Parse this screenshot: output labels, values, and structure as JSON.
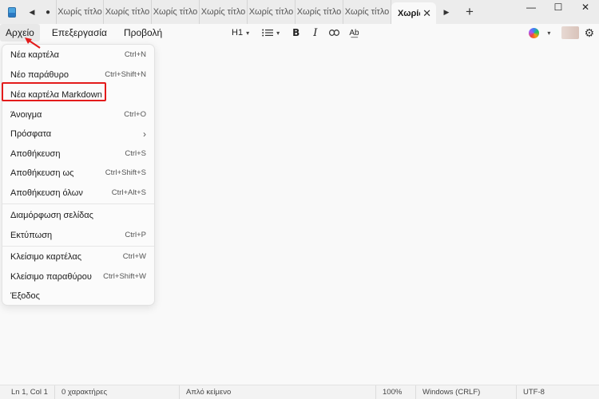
{
  "titlebar": {
    "tabs": [
      "Χωρίς τίτλο",
      "Χωρίς τίτλο",
      "Χωρίς τίτλο",
      "Χωρίς τίτλο",
      "Χωρίς τίτλο",
      "Χωρίς τίτλο",
      "Χωρίς τίτλο"
    ],
    "active_tab": "Χωρίς",
    "close_glyph": "✕",
    "add_glyph": "+",
    "prev_glyph": "◀",
    "dot_glyph": "●",
    "next_glyph": "▶",
    "minimize_glyph": "—",
    "maximize_glyph": "☐",
    "close_window_glyph": "✕"
  },
  "menubar": {
    "file": "Αρχείο",
    "edit": "Επεξεργασία",
    "view": "Προβολή"
  },
  "toolbar": {
    "heading": "H1",
    "bold": "B",
    "italic": "I",
    "icons": [
      "list-icon",
      "link-icon",
      "spellcheck-icon",
      "copilot-icon",
      "settings-icon"
    ]
  },
  "file_menu": {
    "items": [
      {
        "label": "Νέα καρτέλα",
        "shortcut": "Ctrl+N"
      },
      {
        "label": "Νέο παράθυρο",
        "shortcut": "Ctrl+Shift+N"
      },
      {
        "label": "Νέα καρτέλα Markdown",
        "shortcut": ""
      },
      {
        "label": "Άνοιγμα",
        "shortcut": "Ctrl+O"
      },
      {
        "label": "Πρόσφατα",
        "shortcut": "›"
      },
      {
        "label": "Αποθήκευση",
        "shortcut": "Ctrl+S"
      },
      {
        "label": "Αποθήκευση ως",
        "shortcut": "Ctrl+Shift+S"
      },
      {
        "label": "Αποθήκευση όλων",
        "shortcut": "Ctrl+Alt+S"
      },
      {
        "label": "Διαμόρφωση σελίδας",
        "shortcut": ""
      },
      {
        "label": "Εκτύπωση",
        "shortcut": "Ctrl+P"
      },
      {
        "label": "Κλείσιμο καρτέλας",
        "shortcut": "Ctrl+W"
      },
      {
        "label": "Κλείσιμο παραθύρου",
        "shortcut": "Ctrl+Shift+W"
      },
      {
        "label": "Έξοδος",
        "shortcut": ""
      }
    ]
  },
  "annotation": {
    "highlight_color": "#e31b1b"
  },
  "statusbar": {
    "position": "Ln 1, Col 1",
    "chars": "0 χαρακτήρες",
    "format": "Απλό κείμενο",
    "zoom": "100%",
    "line_ending": "Windows (CRLF)",
    "encoding": "UTF-8"
  }
}
